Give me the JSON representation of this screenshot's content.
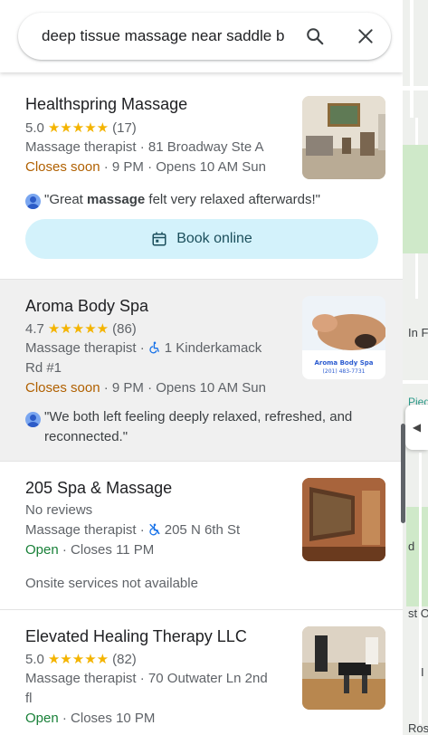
{
  "search": {
    "query": "deep tissue massage near saddle b"
  },
  "results": [
    {
      "name": "Healthspring Massage",
      "rating": "5.0",
      "stars": "★★★★★",
      "reviews": "(17)",
      "category": "Massage therapist",
      "address": "81 Broadway Ste A",
      "status": "Closes soon",
      "hours": "9 PM · Opens 10 AM Sun",
      "review_prefix": "\"Great ",
      "review_bold": "massage",
      "review_suffix": " felt very relaxed afterwards!\"",
      "action": "Book online"
    },
    {
      "name": "Aroma Body Spa",
      "rating": "4.7",
      "stars": "★★★★★",
      "reviews": "(86)",
      "category": "Massage therapist",
      "address_line1": "1 Kinderkamack",
      "address_line2": "Rd #1",
      "status": "Closes soon",
      "hours": "9 PM · Opens 10 AM Sun",
      "review_line1": "\"We both left feeling deeply relaxed, refreshed, and",
      "review_line2": "reconnected.\"",
      "thumb_text1": "Aroma Body Spa",
      "thumb_text2": "(201) 483-7731"
    },
    {
      "name": "205 Spa & Massage",
      "no_reviews": "No reviews",
      "category": "Massage therapist",
      "address": "205 N 6th St",
      "status": "Open",
      "hours": "Closes 11 PM",
      "note": "Onsite services not available"
    },
    {
      "name": "Elevated Healing Therapy LLC",
      "rating": "5.0",
      "stars": "★★★★★",
      "reviews": "(82)",
      "category": "Massage therapist",
      "address_line1": "70 Outwater Ln 2nd",
      "address_line2": "fl",
      "status": "Open",
      "hours": "Closes 10 PM"
    }
  ],
  "map_labels": {
    "a": "In F",
    "b": "Pied",
    "c": "st O",
    "d": "Ros",
    "e": "d",
    "f": "I"
  },
  "colors": {
    "star": "#f4b400",
    "warning": "#b06000",
    "open": "#188038",
    "book_bg": "#d3f2fb"
  }
}
